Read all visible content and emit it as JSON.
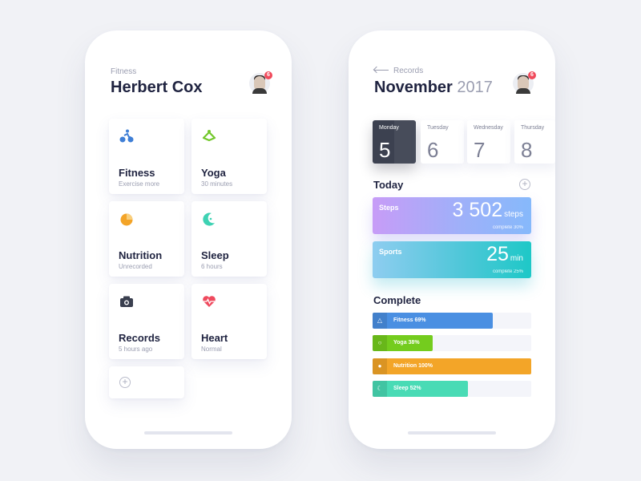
{
  "left_phone": {
    "subtitle": "Fitness",
    "title": "Herbert Cox",
    "avatar_badge": "6",
    "tiles": [
      {
        "title": "Fitness",
        "sub": "Exercise more",
        "icon": "bicycle-icon",
        "color": "#3f7fd6"
      },
      {
        "title": "Yoga",
        "sub": "30 minutes",
        "icon": "yoga-icon",
        "color": "#73c82c"
      },
      {
        "title": "Nutrition",
        "sub": "Unrecorded",
        "icon": "pie-icon",
        "color": "#f3a428"
      },
      {
        "title": "Sleep",
        "sub": "6 hours",
        "icon": "moon-icon",
        "color": "#3ed2b3"
      },
      {
        "title": "Records",
        "sub": "5 hours ago",
        "icon": "camera-icon",
        "color": "#3a3f4f"
      },
      {
        "title": "Heart",
        "sub": "Normal",
        "icon": "heart-icon",
        "color": "#ef4a5e"
      }
    ],
    "add_label": "+"
  },
  "right_phone": {
    "back_label": "Records",
    "month": "November",
    "year": "2017",
    "avatar_badge": "6",
    "days": [
      {
        "name": "Monday",
        "num": "5",
        "active": true
      },
      {
        "name": "Tuesday",
        "num": "6",
        "active": false
      },
      {
        "name": "Wednesday",
        "num": "7",
        "active": false
      },
      {
        "name": "Thursday",
        "num": "8",
        "active": false
      }
    ],
    "today_title": "Today",
    "add_label": "+",
    "steps": {
      "label": "Steps",
      "value": "3 502",
      "unit": "steps",
      "complete": "complete 30%"
    },
    "sports": {
      "label": "Sports",
      "value": "25",
      "unit": "min",
      "complete": "complete 25%"
    },
    "complete_title": "Complete",
    "bars": [
      {
        "label": "Fitness 69%",
        "percent": 76,
        "color": "#4a8fe2",
        "icon": "bicycle-icon"
      },
      {
        "label": "Yoga 38%",
        "percent": 38,
        "color": "#74cc1e",
        "icon": "yoga-icon"
      },
      {
        "label": "Nutrition 100%",
        "percent": 100,
        "color": "#f3a528",
        "icon": "pie-icon"
      },
      {
        "label": "Sleep 52%",
        "percent": 60,
        "color": "#49dbb5",
        "icon": "moon-icon"
      }
    ]
  }
}
